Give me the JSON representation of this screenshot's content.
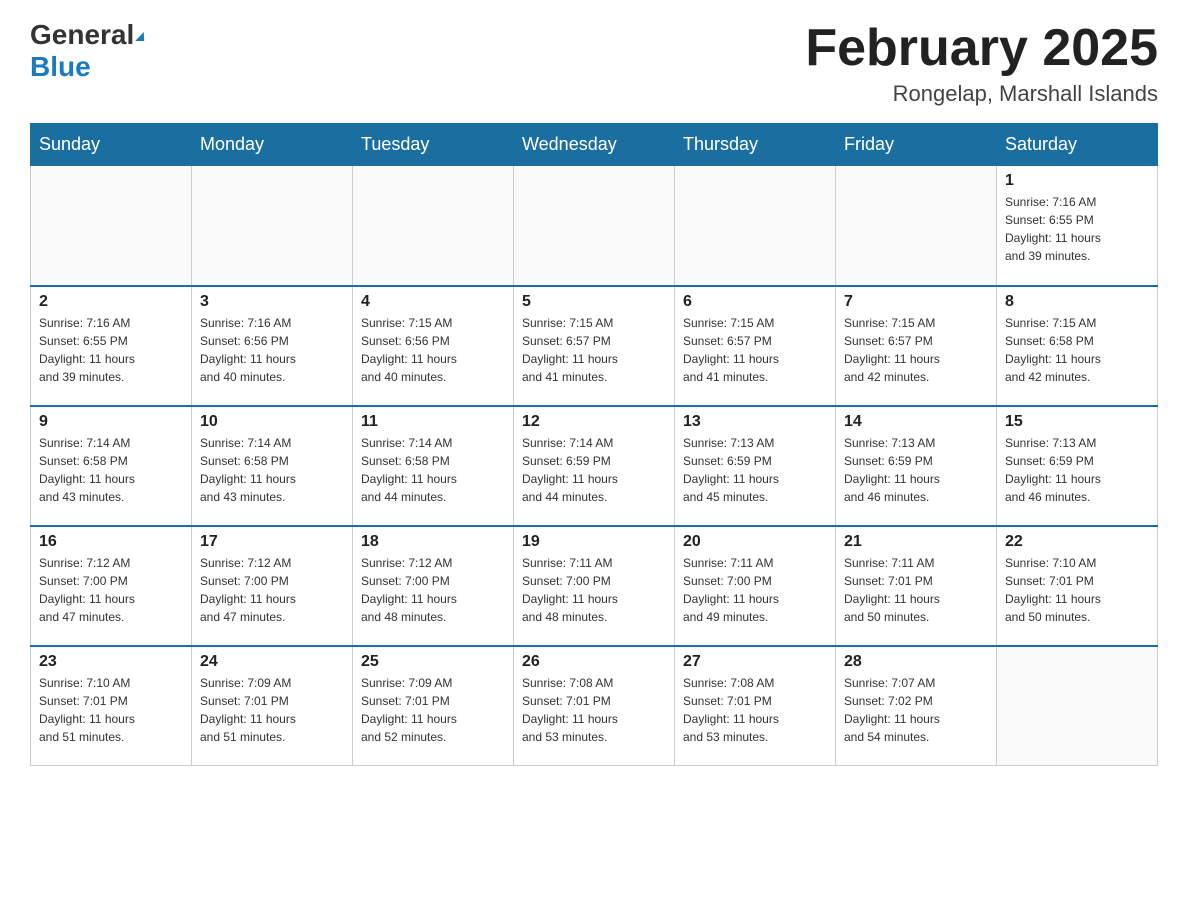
{
  "header": {
    "logo_general": "General",
    "logo_blue": "Blue",
    "month_title": "February 2025",
    "location": "Rongelap, Marshall Islands"
  },
  "weekdays": [
    "Sunday",
    "Monday",
    "Tuesday",
    "Wednesday",
    "Thursday",
    "Friday",
    "Saturday"
  ],
  "weeks": [
    [
      {
        "day": "",
        "info": ""
      },
      {
        "day": "",
        "info": ""
      },
      {
        "day": "",
        "info": ""
      },
      {
        "day": "",
        "info": ""
      },
      {
        "day": "",
        "info": ""
      },
      {
        "day": "",
        "info": ""
      },
      {
        "day": "1",
        "info": "Sunrise: 7:16 AM\nSunset: 6:55 PM\nDaylight: 11 hours\nand 39 minutes."
      }
    ],
    [
      {
        "day": "2",
        "info": "Sunrise: 7:16 AM\nSunset: 6:55 PM\nDaylight: 11 hours\nand 39 minutes."
      },
      {
        "day": "3",
        "info": "Sunrise: 7:16 AM\nSunset: 6:56 PM\nDaylight: 11 hours\nand 40 minutes."
      },
      {
        "day": "4",
        "info": "Sunrise: 7:15 AM\nSunset: 6:56 PM\nDaylight: 11 hours\nand 40 minutes."
      },
      {
        "day": "5",
        "info": "Sunrise: 7:15 AM\nSunset: 6:57 PM\nDaylight: 11 hours\nand 41 minutes."
      },
      {
        "day": "6",
        "info": "Sunrise: 7:15 AM\nSunset: 6:57 PM\nDaylight: 11 hours\nand 41 minutes."
      },
      {
        "day": "7",
        "info": "Sunrise: 7:15 AM\nSunset: 6:57 PM\nDaylight: 11 hours\nand 42 minutes."
      },
      {
        "day": "8",
        "info": "Sunrise: 7:15 AM\nSunset: 6:58 PM\nDaylight: 11 hours\nand 42 minutes."
      }
    ],
    [
      {
        "day": "9",
        "info": "Sunrise: 7:14 AM\nSunset: 6:58 PM\nDaylight: 11 hours\nand 43 minutes."
      },
      {
        "day": "10",
        "info": "Sunrise: 7:14 AM\nSunset: 6:58 PM\nDaylight: 11 hours\nand 43 minutes."
      },
      {
        "day": "11",
        "info": "Sunrise: 7:14 AM\nSunset: 6:58 PM\nDaylight: 11 hours\nand 44 minutes."
      },
      {
        "day": "12",
        "info": "Sunrise: 7:14 AM\nSunset: 6:59 PM\nDaylight: 11 hours\nand 44 minutes."
      },
      {
        "day": "13",
        "info": "Sunrise: 7:13 AM\nSunset: 6:59 PM\nDaylight: 11 hours\nand 45 minutes."
      },
      {
        "day": "14",
        "info": "Sunrise: 7:13 AM\nSunset: 6:59 PM\nDaylight: 11 hours\nand 46 minutes."
      },
      {
        "day": "15",
        "info": "Sunrise: 7:13 AM\nSunset: 6:59 PM\nDaylight: 11 hours\nand 46 minutes."
      }
    ],
    [
      {
        "day": "16",
        "info": "Sunrise: 7:12 AM\nSunset: 7:00 PM\nDaylight: 11 hours\nand 47 minutes."
      },
      {
        "day": "17",
        "info": "Sunrise: 7:12 AM\nSunset: 7:00 PM\nDaylight: 11 hours\nand 47 minutes."
      },
      {
        "day": "18",
        "info": "Sunrise: 7:12 AM\nSunset: 7:00 PM\nDaylight: 11 hours\nand 48 minutes."
      },
      {
        "day": "19",
        "info": "Sunrise: 7:11 AM\nSunset: 7:00 PM\nDaylight: 11 hours\nand 48 minutes."
      },
      {
        "day": "20",
        "info": "Sunrise: 7:11 AM\nSunset: 7:00 PM\nDaylight: 11 hours\nand 49 minutes."
      },
      {
        "day": "21",
        "info": "Sunrise: 7:11 AM\nSunset: 7:01 PM\nDaylight: 11 hours\nand 50 minutes."
      },
      {
        "day": "22",
        "info": "Sunrise: 7:10 AM\nSunset: 7:01 PM\nDaylight: 11 hours\nand 50 minutes."
      }
    ],
    [
      {
        "day": "23",
        "info": "Sunrise: 7:10 AM\nSunset: 7:01 PM\nDaylight: 11 hours\nand 51 minutes."
      },
      {
        "day": "24",
        "info": "Sunrise: 7:09 AM\nSunset: 7:01 PM\nDaylight: 11 hours\nand 51 minutes."
      },
      {
        "day": "25",
        "info": "Sunrise: 7:09 AM\nSunset: 7:01 PM\nDaylight: 11 hours\nand 52 minutes."
      },
      {
        "day": "26",
        "info": "Sunrise: 7:08 AM\nSunset: 7:01 PM\nDaylight: 11 hours\nand 53 minutes."
      },
      {
        "day": "27",
        "info": "Sunrise: 7:08 AM\nSunset: 7:01 PM\nDaylight: 11 hours\nand 53 minutes."
      },
      {
        "day": "28",
        "info": "Sunrise: 7:07 AM\nSunset: 7:02 PM\nDaylight: 11 hours\nand 54 minutes."
      },
      {
        "day": "",
        "info": ""
      }
    ]
  ]
}
